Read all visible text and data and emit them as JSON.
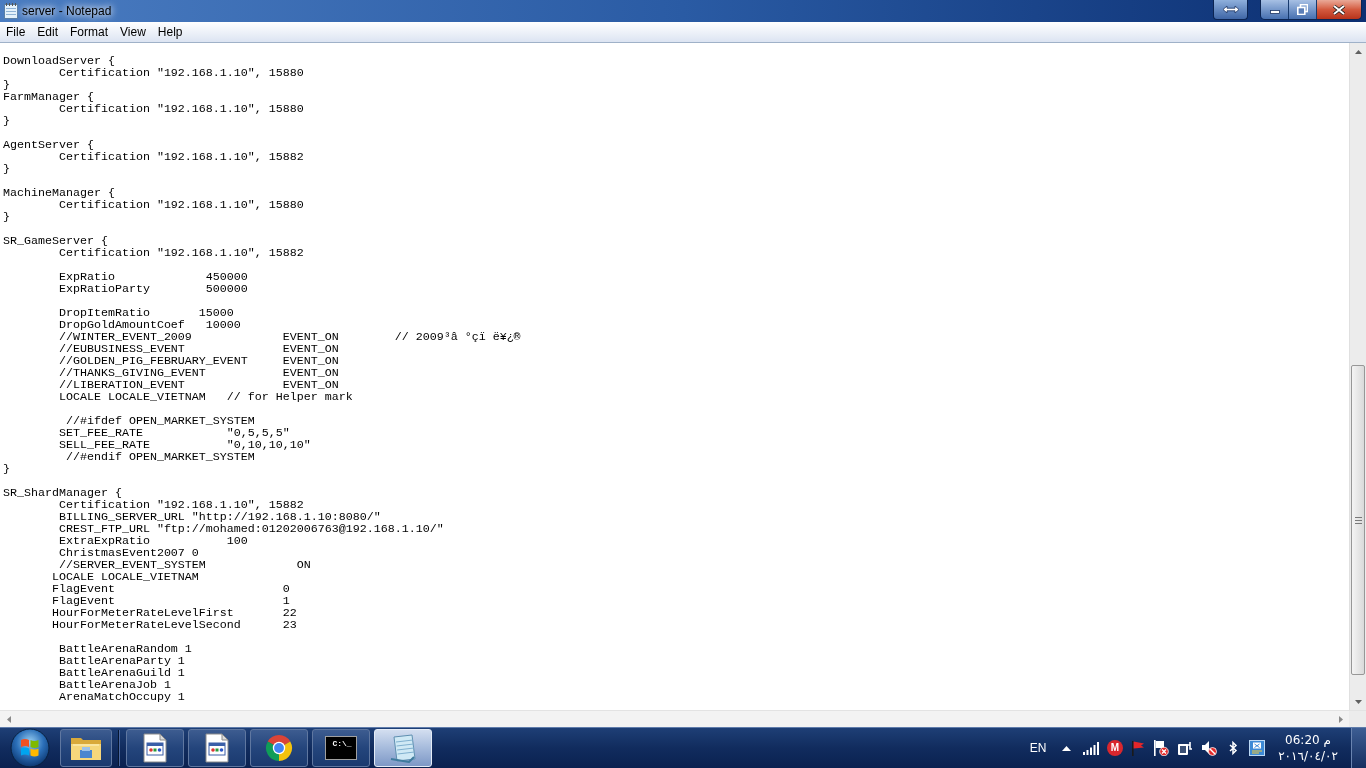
{
  "window": {
    "title": "server - Notepad"
  },
  "menu": [
    {
      "label": "File"
    },
    {
      "label": "Edit"
    },
    {
      "label": "Format"
    },
    {
      "label": "View"
    },
    {
      "label": "Help"
    }
  ],
  "editor": {
    "paragraphs": [
      [
        "DownloadServer {",
        "        Certification \"192.168.1.10\", 15880",
        "}",
        "FarmManager {",
        "        Certification \"192.168.1.10\", 15880",
        "}"
      ],
      [
        "AgentServer {",
        "        Certification \"192.168.1.10\", 15882",
        "}"
      ],
      [
        "MachineManager {",
        "        Certification \"192.168.1.10\", 15880",
        "}"
      ],
      [
        "SR_GameServer {",
        "        Certification \"192.168.1.10\", 15882"
      ],
      [
        "        ExpRatio             450000",
        "        ExpRatioParty        500000"
      ],
      [
        "        DropItemRatio       15000",
        "        DropGoldAmountCoef   10000",
        "        //WINTER_EVENT_2009             EVENT_ON        // 2009³â °çï ë¥¿®",
        "        //EUBUSINESS_EVENT              EVENT_ON",
        "        //GOLDEN_PIG_FEBRUARY_EVENT     EVENT_ON",
        "        //THANKS_GIVING_EVENT           EVENT_ON",
        "        //LIBERATION_EVENT              EVENT_ON",
        "        LOCALE LOCALE_VIETNAM   // for Helper mark"
      ],
      [
        "         //#ifdef OPEN_MARKET_SYSTEM",
        "        SET_FEE_RATE            \"0,5,5,5\"",
        "        SELL_FEE_RATE           \"0,10,10,10\"",
        "         //#endif OPEN_MARKET_SYSTEM",
        "}"
      ],
      [
        "SR_ShardManager {",
        "        Certification \"192.168.1.10\", 15882",
        "        BILLING_SERVER_URL \"http://192.168.1.10:8080/\"",
        "        CREST_FTP_URL \"ftp://mohamed:01202006763@192.168.1.10/\"",
        "        ExtraExpRatio           100",
        "        ChristmasEvent2007 0",
        "        //SERVER_EVENT_SYSTEM             ON",
        "       LOCALE LOCALE_VIETNAM",
        "       FlagEvent                        0",
        "       FlagEvent                        1",
        "       HourForMeterRateLevelFirst       22",
        "       HourForMeterRateLevelSecond      23"
      ],
      [
        "        BattleArenaRandom 1",
        "        BattleArenaParty 1",
        "        BattleArenaGuild 1",
        "        BattleArenaJob 1",
        "        ArenaMatchOccupy 1"
      ]
    ]
  },
  "taskbar": {
    "buttons": [
      {
        "kind": "folder",
        "active": false
      },
      {
        "kind": "document",
        "active": false
      },
      {
        "kind": "document",
        "active": false
      },
      {
        "kind": "browser",
        "active": false
      },
      {
        "kind": "terminal",
        "active": false,
        "icon_text": "C:\\_"
      },
      {
        "kind": "notepad",
        "active": true
      }
    ],
    "tray": {
      "language": "EN",
      "logo_letter": "M"
    },
    "clock": {
      "time": "06:20 م",
      "date": "٢٠١٦/٠٤/٠٢"
    }
  }
}
